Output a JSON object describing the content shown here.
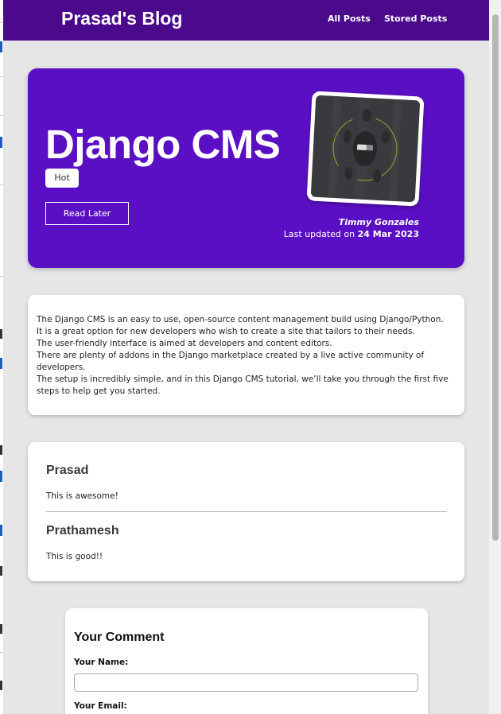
{
  "navbar": {
    "brand": "Prasad's Blog",
    "links": [
      "All Posts",
      "Stored Posts"
    ],
    "background": "#4b0a8c"
  },
  "post": {
    "title": "Django CMS",
    "tag": "Hot",
    "read_later_label": "Read Later",
    "author": "Timmy Gonzales",
    "updated_prefix": "Last updated on",
    "updated_date": "24 Mar 2023",
    "image_icon": "django-cms-thumbnail",
    "accent": "#5b0fc4",
    "content": [
      "The Django CMS is an easy to use, open-source content management build using Django/Python.",
      "It is a great option for new developers who wish to create a site that tailors to their needs.",
      "The user-friendly interface is aimed at developers and content editors.",
      "There are plenty of addons in the Django marketplace created by a live active community of developers.",
      "The setup is incredibly simple, and in this Django CMS tutorial, we’ll take you through the first five steps to help get you started."
    ]
  },
  "comments": [
    {
      "name": "Prasad",
      "text": "This is awesome!"
    },
    {
      "name": "Prathamesh",
      "text": "This is good!!"
    }
  ],
  "comment_form": {
    "title": "Your Comment",
    "name_label": "Your Name:",
    "email_label": "Your Email:",
    "name_value": ""
  }
}
